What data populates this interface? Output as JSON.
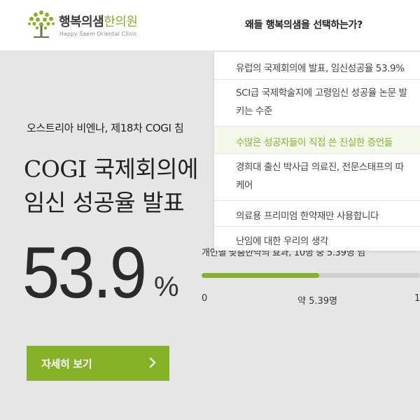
{
  "colors": {
    "accent": "#86b229",
    "background": "#e6e6e6",
    "dropdown_active_bg": "#f4f8ea"
  },
  "header": {
    "logo": {
      "name_main": "행복의샘",
      "name_accent": "한의원",
      "subtitle": "Happy Saem Oriental Clinic",
      "icon": "tree-logo-icon"
    },
    "nav_title": "왜들 행복의샘을 선택하는가?"
  },
  "dropdown": {
    "items": [
      {
        "label": "유럽의 국제회의에 발표, 임신성공율 53.9%"
      },
      {
        "line1": "SCI급 국제학술지에 고령임신 성공율 논문 발",
        "line2": "키는 수준"
      },
      {
        "label": "수많은 성공자들이 직접 쓴 진실한 증언들"
      },
      {
        "line1": "경희대 출신 박사급 의료진, 전문스태프의 따",
        "line2": "케어"
      },
      {
        "label": "의료용 프리미엄 한약재만 사용합니다"
      },
      {
        "label": "난임에 대한 우리의 생각"
      }
    ],
    "active_index": 2
  },
  "hero": {
    "subtitle": "오스트리아 비엔나, 제18차 COGI 침",
    "headline_line1": "COGI 국제회의에",
    "headline_line2": "임신 성공율 발표",
    "big_number": "53.9",
    "unit": "%"
  },
  "stat": {
    "label": "개인별 맞춤한약의 효과, 10명 중 5.39명 임",
    "progress_fraction": 0.539,
    "tick_start": "0",
    "tick_mid": "약 5.39명",
    "tick_end": "1"
  },
  "cta": {
    "label": "자세히 보기",
    "icon": "chevron-right-icon"
  }
}
